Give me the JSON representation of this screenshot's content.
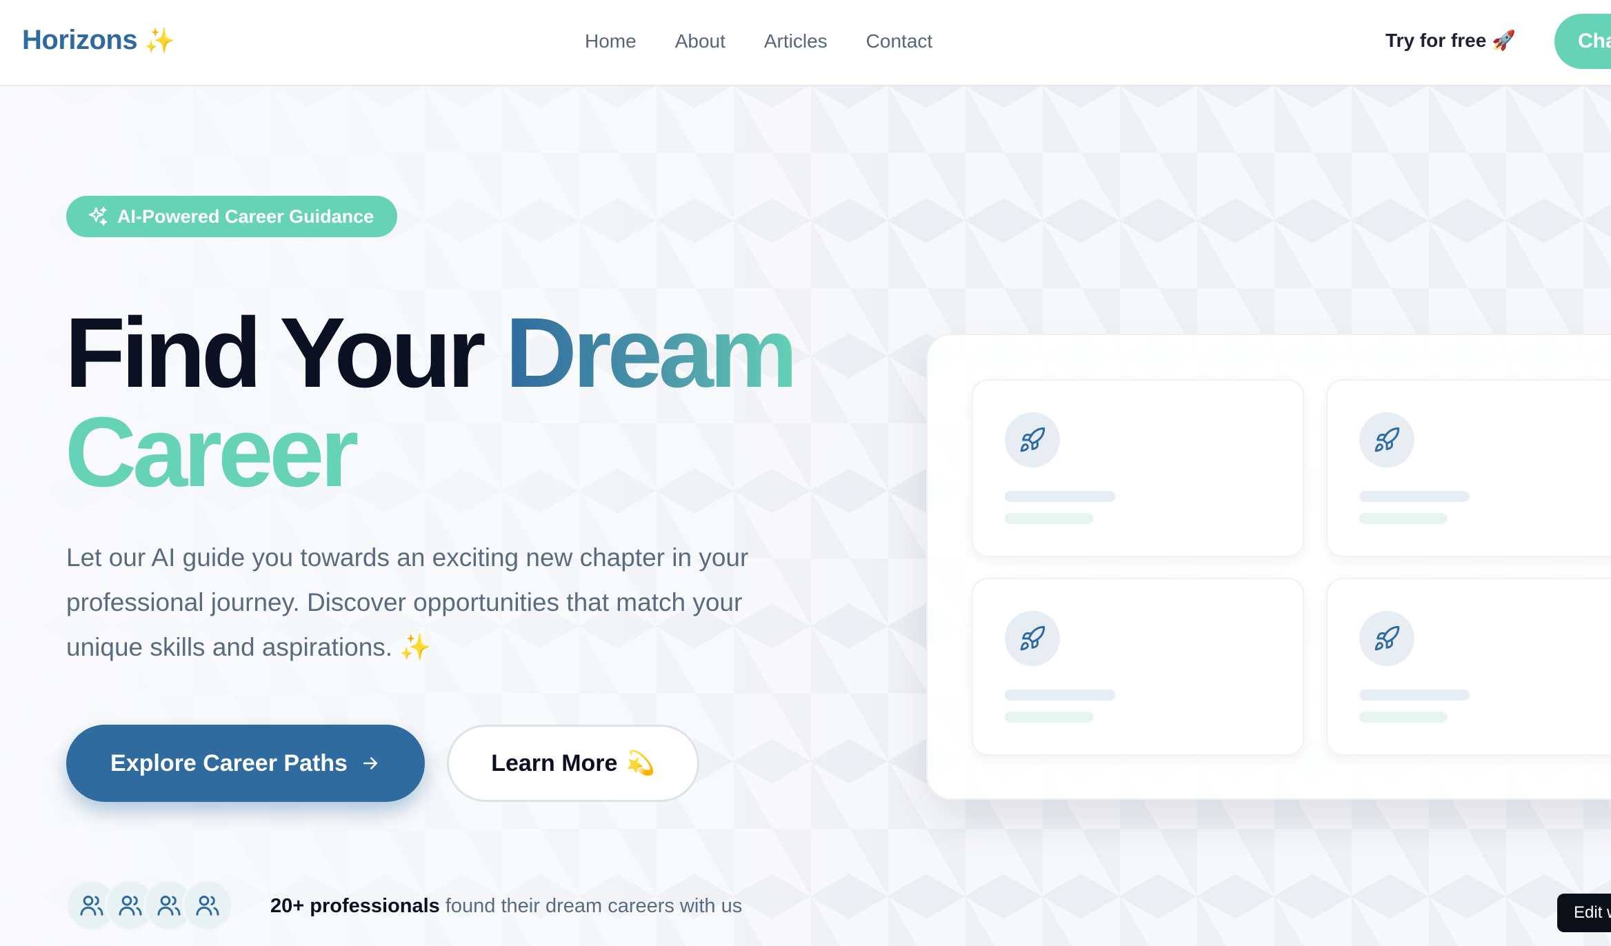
{
  "header": {
    "logo_text": "Horizons",
    "logo_emoji": "✨",
    "nav": [
      "Home",
      "About",
      "Articles",
      "Contact"
    ],
    "try_free_label": "Try for free",
    "try_free_emoji": "🚀",
    "cta_label": "Cha"
  },
  "hero": {
    "badge_label": "AI-Powered Career Guidance",
    "headline_part1": "Find Your ",
    "headline_highlight": "Dream",
    "headline_part2": "Career",
    "subtext": "Let our AI guide you towards an exciting new chapter in your professional journey. Discover opportunities that match your unique skills and aspirations. ✨",
    "primary_button_label": "Explore Career Paths",
    "secondary_button_label": "Learn More",
    "secondary_button_emoji": "💫",
    "social_proof_count": "20+ professionals",
    "social_proof_text": " found their dream careers with us"
  },
  "panel": {
    "cards": [
      {
        "icon": "rocket-icon"
      },
      {
        "icon": "rocket-icon"
      },
      {
        "icon": "rocket-icon"
      },
      {
        "icon": "rocket-icon"
      }
    ]
  },
  "edit_label": "Edit w",
  "colors": {
    "brand_blue": "#2f6b9e",
    "accent_mint": "#66d2b6",
    "heading": "#0b1122",
    "body_text": "#5a6a80"
  }
}
